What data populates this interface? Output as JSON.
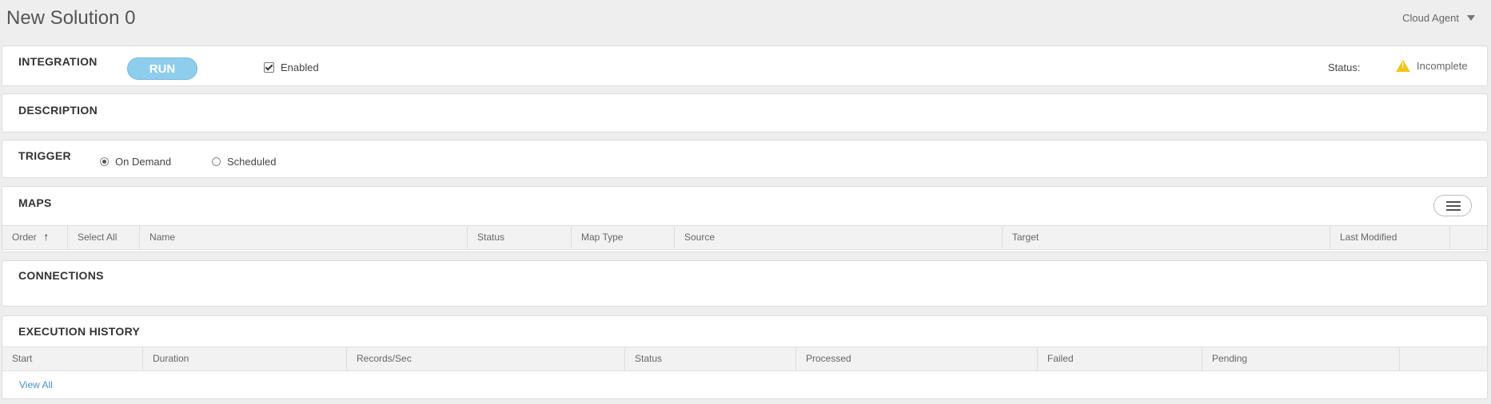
{
  "header": {
    "title": "New Solution 0",
    "agent": "Cloud Agent"
  },
  "integration": {
    "title": "INTEGRATION",
    "run_label": "RUN",
    "enabled_label": "Enabled",
    "enabled": true,
    "status_label": "Status:",
    "status_value": "Incomplete",
    "status_color": "#f0c419"
  },
  "description": {
    "title": "DESCRIPTION"
  },
  "trigger": {
    "title": "TRIGGER",
    "options": [
      "On Demand",
      "Scheduled"
    ],
    "selected": "On Demand"
  },
  "maps": {
    "title": "MAPS",
    "columns": [
      "Order",
      "Select All",
      "Name",
      "Status",
      "Map Type",
      "Source",
      "Target",
      "Last Modified"
    ]
  },
  "connections": {
    "title": "CONNECTIONS"
  },
  "execution_history": {
    "title": "EXECUTION HISTORY",
    "columns": [
      "Start",
      "Duration",
      "Records/Sec",
      "Status",
      "Processed",
      "Failed",
      "Pending"
    ],
    "view_all_label": "View All"
  },
  "colors": {
    "accent": "#8fcdec",
    "link": "#4a90c9",
    "background": "#eeeeee"
  }
}
